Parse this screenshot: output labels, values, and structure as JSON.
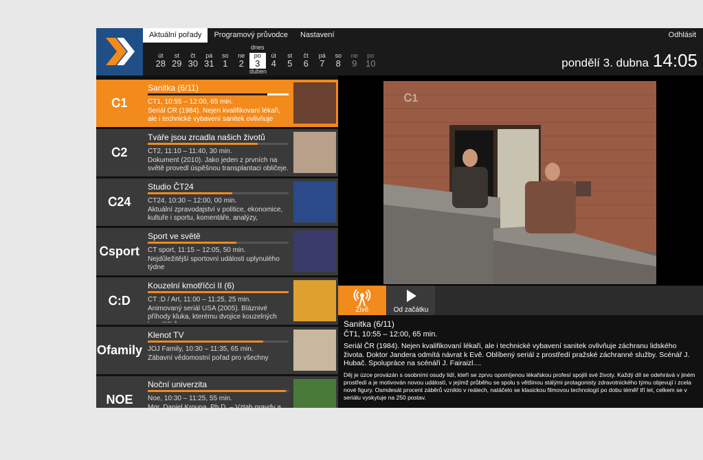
{
  "tabs": [
    {
      "label": "Aktuální pořady",
      "active": true
    },
    {
      "label": "Programový průvodce"
    },
    {
      "label": "Nastavení"
    }
  ],
  "logout_label": "Odhlásit",
  "today_label": "dnes",
  "month_label": "duben",
  "days": [
    {
      "dn": "út",
      "dd": "28"
    },
    {
      "dn": "st",
      "dd": "29"
    },
    {
      "dn": "čt",
      "dd": "30"
    },
    {
      "dn": "pá",
      "dd": "31"
    },
    {
      "dn": "so",
      "dd": "1"
    },
    {
      "dn": "ne",
      "dd": "2"
    },
    {
      "dn": "po",
      "dd": "3",
      "today": true
    },
    {
      "dn": "út",
      "dd": "4"
    },
    {
      "dn": "st",
      "dd": "5"
    },
    {
      "dn": "čt",
      "dd": "6"
    },
    {
      "dn": "pá",
      "dd": "7"
    },
    {
      "dn": "so",
      "dd": "8"
    },
    {
      "dn": "ne",
      "dd": "9",
      "future": true
    },
    {
      "dn": "po",
      "dd": "10",
      "future": true
    }
  ],
  "date": "pondělí 3. dubna",
  "time": "14:05",
  "channels": [
    {
      "logo": "Ꮯ1",
      "title": "Sanitka (6/11)",
      "meta": "ČT1, 10:55 – 12:00, 65 min.",
      "desc": "Seriál ČR (1984). Nejen kvalifikovaní lékaři, ale i technické vybavení sanitek ovlivňuje",
      "progress": 0.85,
      "active": true
    },
    {
      "logo": "Ꮯ2",
      "title": "Tváře jsou zrcadla našich životů",
      "meta": "ČT2, 11:10 – 11:40, 30 min.",
      "desc": "Dokument (2010). Jako jeden z prvních na světě provedl úspěšnou transplantaci obličeje.",
      "progress": 0.78
    },
    {
      "logo": "Ꮯ24",
      "title": "Studio ČT24",
      "meta": "ČT24, 10:30 – 12:00, 00 min.",
      "desc": "Aktuální zpravodajství v politice, ekonomice, kultuře i sportu, komentáře, analýzy,",
      "progress": 0.6
    },
    {
      "logo": "Ꮯsport",
      "title": "Sport ve světě",
      "meta": "ČT sport, 11:15 – 12:05, 50 min.",
      "desc": "Nejdůležitější sportovní události uplynulého týdne",
      "progress": 0.63
    },
    {
      "logo": "Ꮯ:D",
      "title": "Kouzelní kmotříčci II (6)",
      "meta": "ČT :D / Art, 11:00 – 11:25, 25 min.",
      "desc": "Animovaný seriál USA (2005). Bláznivé příhody kluka, kterému dvojice kouzelných kmotříčků",
      "progress": 1.0
    },
    {
      "logo": "Ofamily",
      "title": "Klenot TV",
      "meta": "JOJ Family, 10:30 – 11:35, 65 min.",
      "desc": "Zábavní vědomostní pořad pro všechny",
      "progress": 0.82
    },
    {
      "logo": "NOE",
      "title": "Noční univerzita",
      "meta": "Noe, 10:30 – 11:25, 55 min.",
      "desc": "Mgr. Daniel Krouna, Ph.D. – Vztah pravdy a",
      "progress": 0.98
    }
  ],
  "controls": {
    "live": "Živě",
    "start": "Od začátku"
  },
  "info": {
    "title": "Sanitka (6/11)",
    "meta": "ČT1, 10:55 – 12:00, 65 min.",
    "desc": "Seriál ČR (1984). Nejen kvalifikovaní lékaři, ale i technické vybavení sanitek ovlivňuje záchranu lidského života. Doktor Jandera odmítá návrat k Evě. Oblíbený seriál z prostředí pražské záchranné služby. Scénář J. Hubač. Spolupráce na scénáři J. Fairaizl....",
    "long": "Děj je úzce provázán s osobními osudy lidí, kteří se zprvu opomíjenou lékařskou profesí spojili své životy. Každý díl se odehrává v jiném prostředí a je motivován novou událostí, v jejímž průběhu se spolu s většinou stálými protagonisty zdravotnického týmu objevují i zcela nové figury. Osmdesát procent záběrů vzniklo v reálech, natáčelo se klasickou filmovou technologií po dobu téměř tří let, celkem se v seriálu vyskytuje na 250 postav."
  },
  "video_logo": "Ꮯ1",
  "colors": {
    "accent": "#f28a1c",
    "brand": "#1f4f86"
  }
}
